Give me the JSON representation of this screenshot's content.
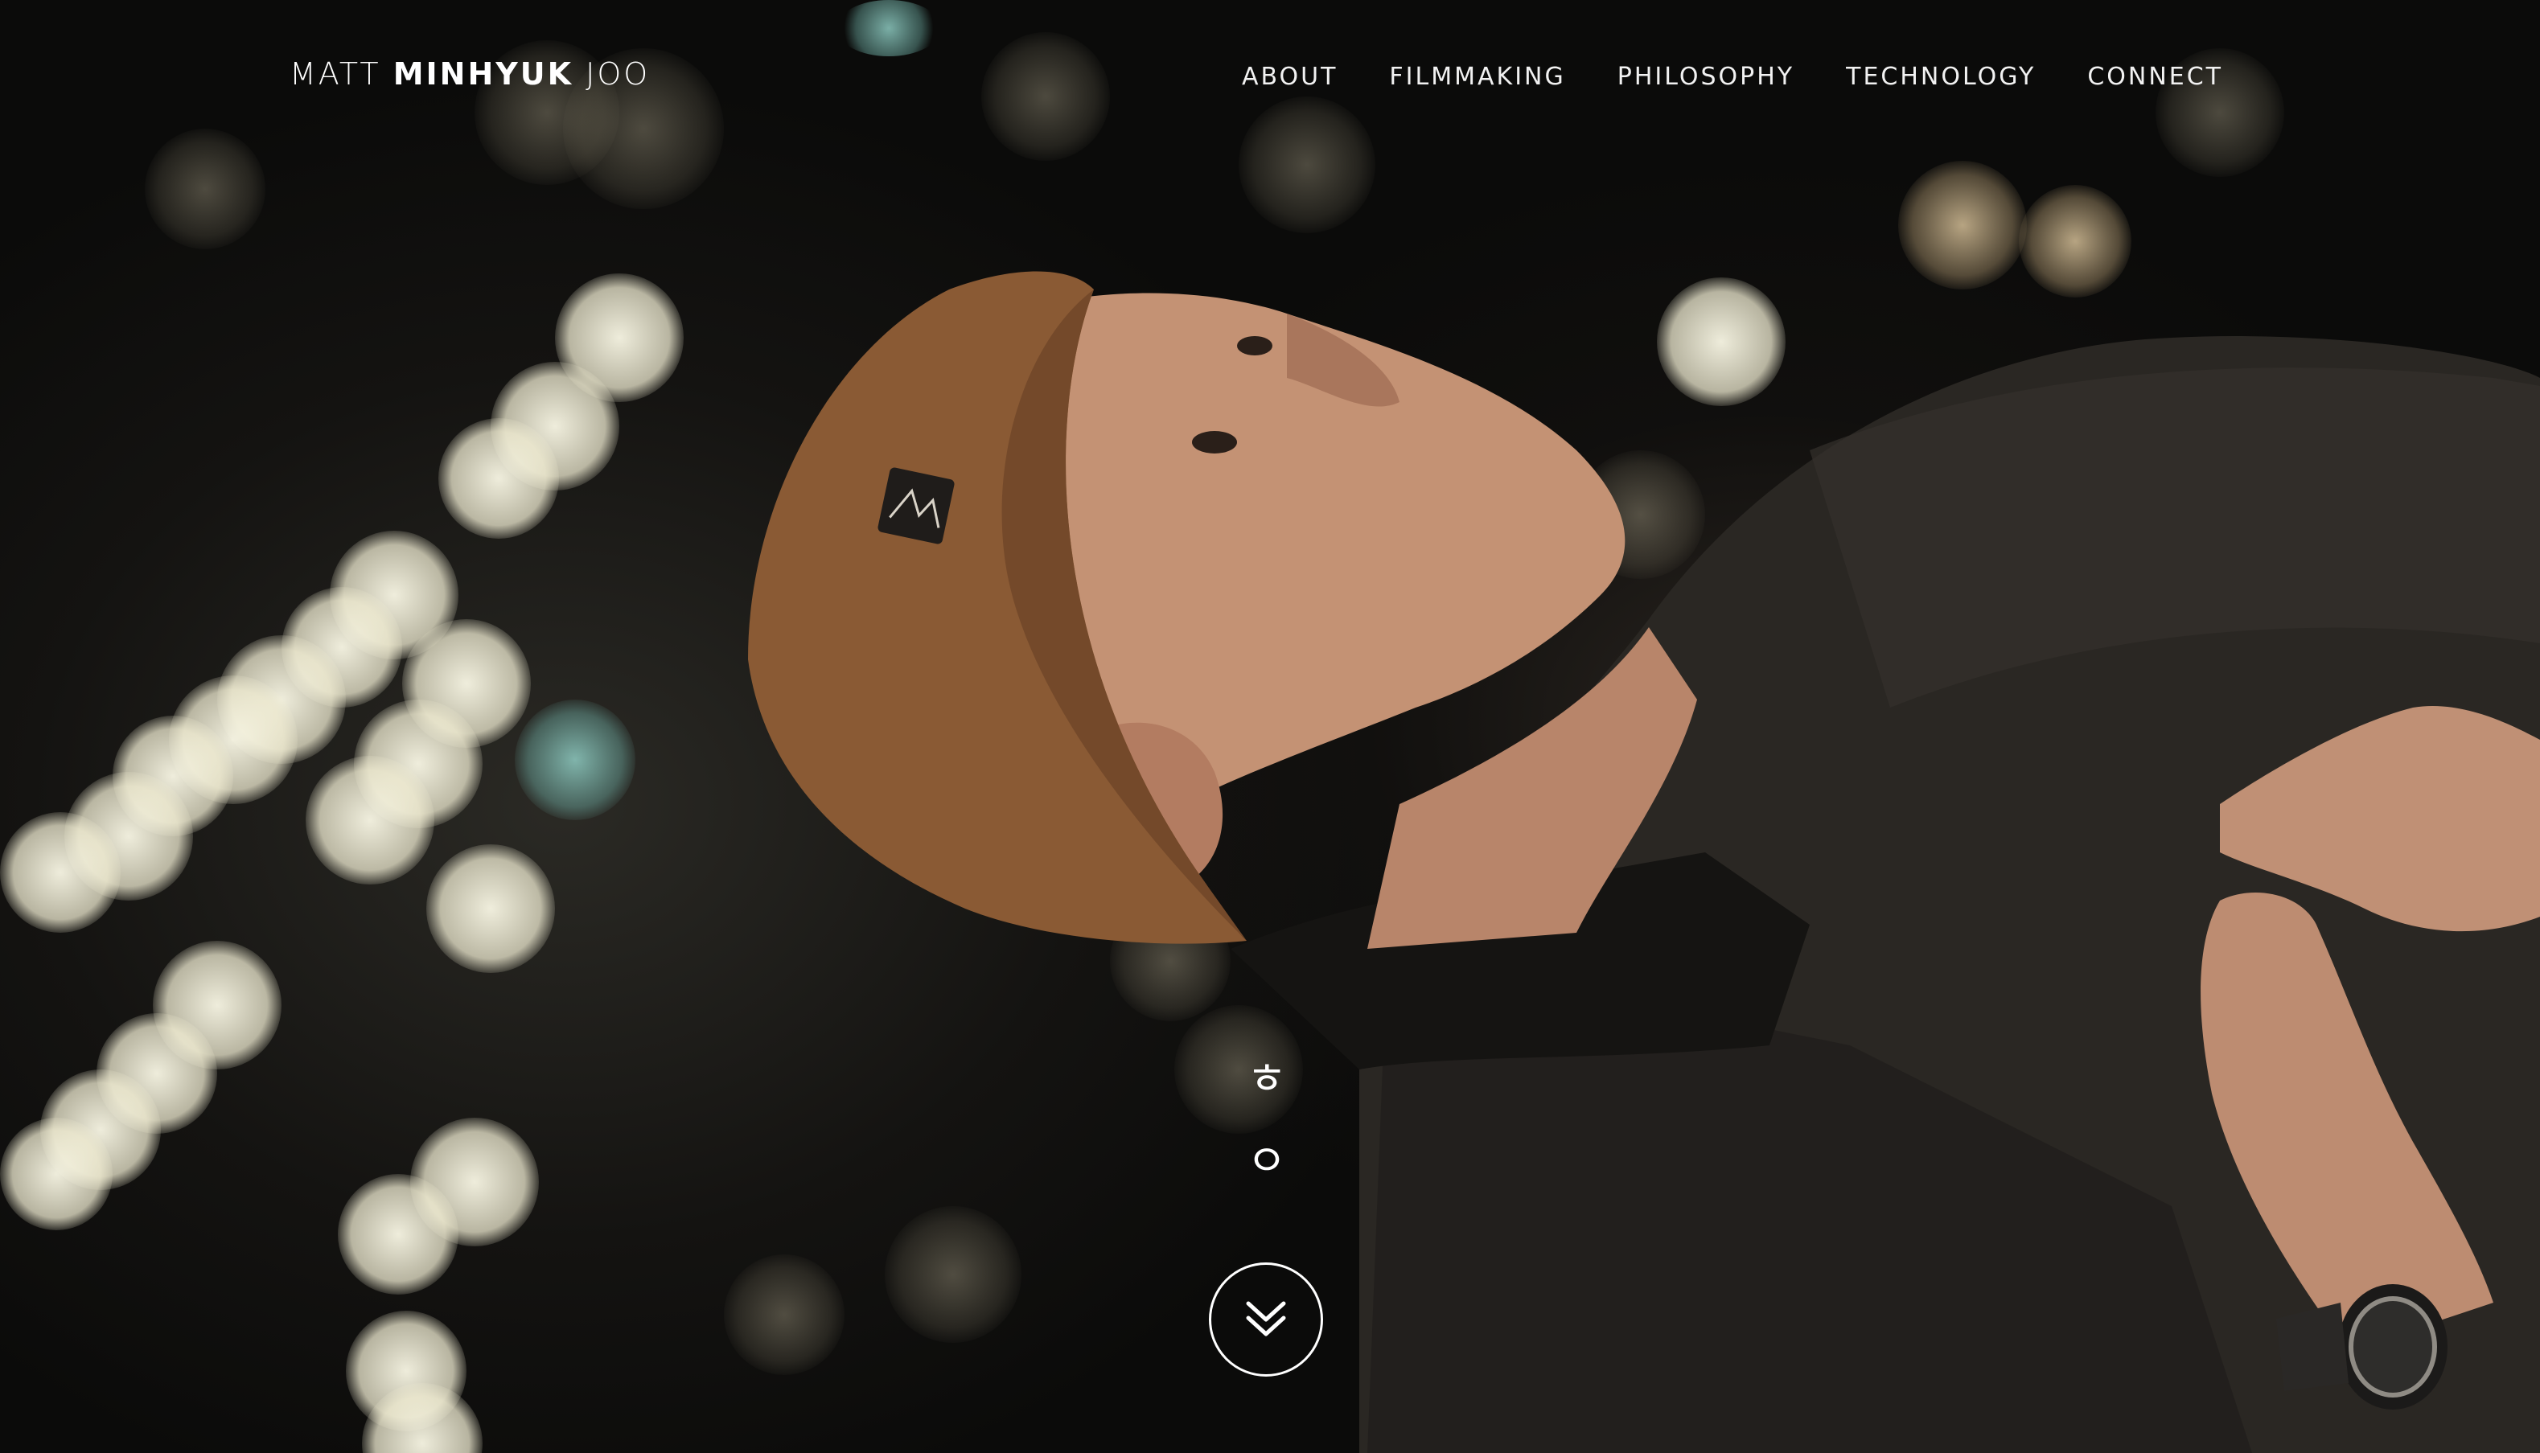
{
  "header": {
    "logo": {
      "first": "MATT",
      "middle": "MINHYUK",
      "last": "JOO"
    },
    "nav": [
      {
        "label": "ABOUT"
      },
      {
        "label": "FILMMAKING"
      },
      {
        "label": "PHILOSOPHY"
      },
      {
        "label": "TECHNOLOGY"
      },
      {
        "label": "CONNECT"
      }
    ]
  },
  "hero": {
    "vertical_text": [
      "ㅎ",
      "ㅇ"
    ],
    "scroll_button_icon": "double-chevron-down-icon"
  },
  "colors": {
    "text": "#ffffff",
    "background": "#0b0b0a",
    "beanie": "#8a5a34",
    "jacket": "#2b2824"
  }
}
